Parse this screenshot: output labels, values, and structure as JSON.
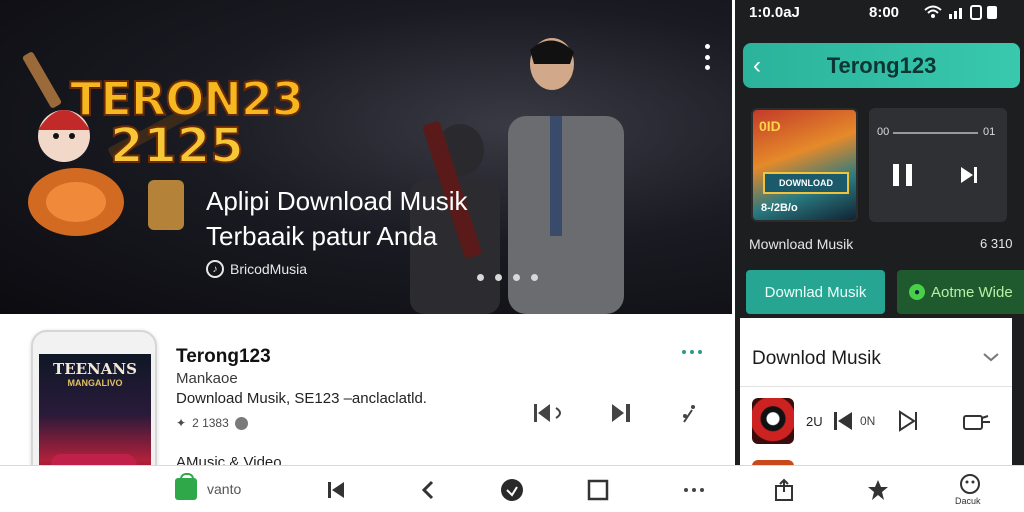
{
  "hero": {
    "logo_line1": "TERON23",
    "logo_line2": "2125",
    "headline_line1": "Aplipi Download Musik",
    "headline_line2": "Terbaaik patur Anda",
    "brand": "BricodMusia",
    "brand_icon": "music-note-icon",
    "carousel_dots": 4
  },
  "status_bar": {
    "time_left": "1:0.0aJ",
    "time_right": "8:00",
    "icons": "wifi-icon signal-icon battery-icon"
  },
  "side_panel": {
    "title": "Terong123",
    "album_top": "0ID",
    "album_banner": "DOWNLOAD",
    "album_bottom": "8-/2B/o",
    "player_time_left": "00",
    "player_time_right": "01",
    "caption_left": "Mownload Musik",
    "caption_right": "6 310",
    "button_primary": "Downlad Musik",
    "button_secondary": "Aotme Wide",
    "sheet_title": "Downlod Musik",
    "row_left": "2U",
    "row_mid": "0N"
  },
  "card": {
    "app_name": "Terong123",
    "developer": "Mankaoe",
    "description": "Download Musik, SE123 –anclaclatld.",
    "stats": "2 1383",
    "category": "AMusic & Video",
    "phone_title": "TEENANS",
    "phone_subtitle": "MANGALIVO"
  },
  "bottom_bar": {
    "store_label": "vanto",
    "u_label": "Dacuk"
  },
  "colors": {
    "accent_teal": "#27a593",
    "header_teal": "#38c9ae",
    "green": "#1f5a2e"
  }
}
